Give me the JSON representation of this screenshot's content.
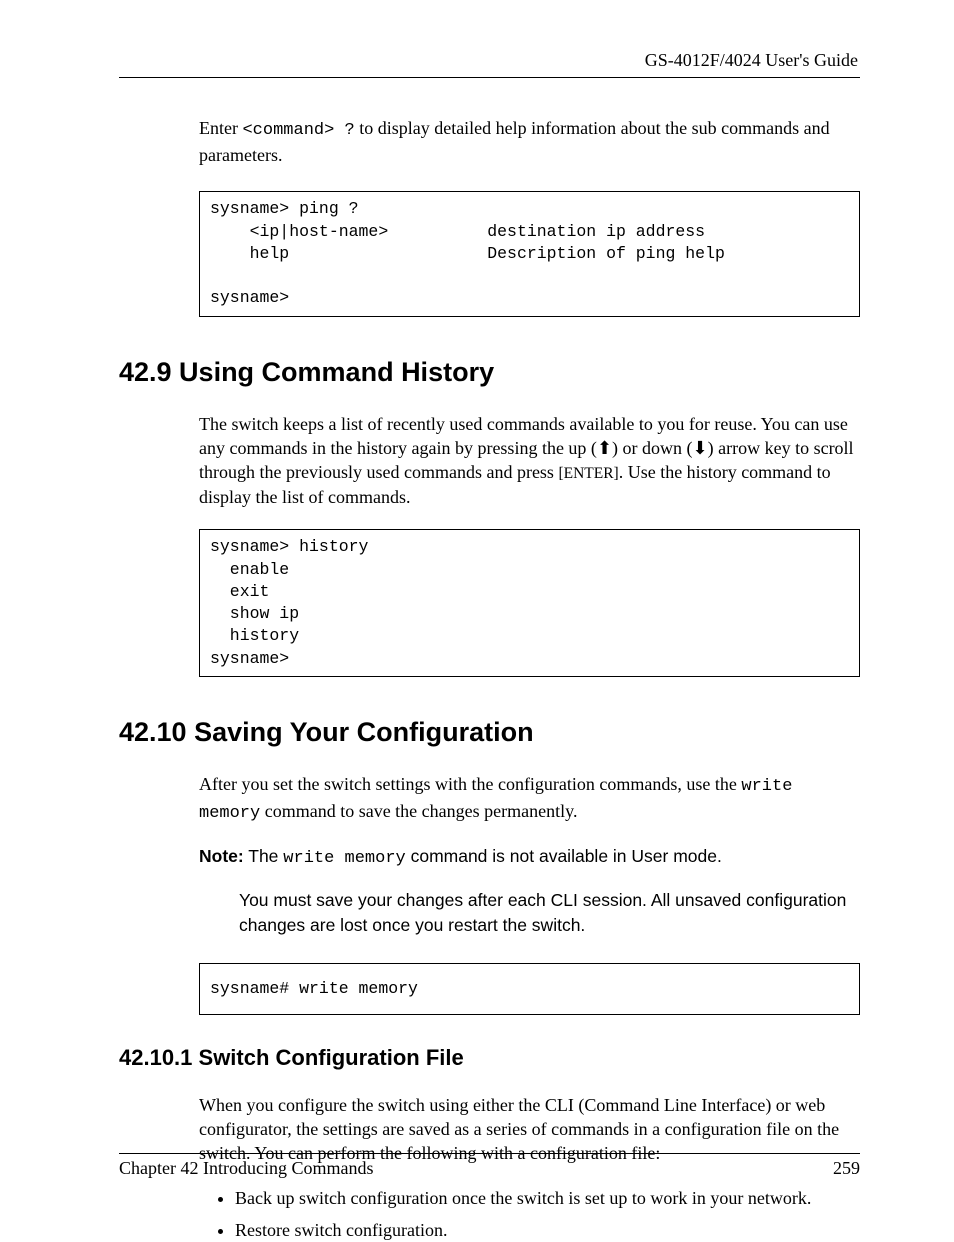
{
  "header": {
    "running": "GS-4012F/4024 User's Guide"
  },
  "intro": {
    "pre": "Enter ",
    "cmd": "<command> ?",
    "post": " to display detailed help information about the sub commands and parameters."
  },
  "code1": "sysname> ping ?\n    <ip|host-name>          destination ip address\n    help                    Description of ping help\n\nsysname>",
  "s1": {
    "heading": "42.9  Using Command History",
    "p1a": "The switch keeps a list of recently used commands available to you for reuse. You can use any commands in the history again by pressing the up (",
    "up": "⬆",
    "p1b": ") or down (",
    "down": "⬇",
    "p1c": ") arrow key to scroll through the previously used commands and press ",
    "enter": "[ENTER]",
    "p1d": ". Use the history command to display the list of commands."
  },
  "code2": "sysname> history\n  enable\n  exit\n  show ip\n  history\nsysname>",
  "s2": {
    "heading": "42.10  Saving Your Configuration",
    "p1a": "After you set the switch settings with the configuration commands, use the ",
    "cmd1": "write memory",
    "p1b": " command to save the changes permanently.",
    "note_label": "Note:",
    "note_a": " The ",
    "note_cmd": "write memory",
    "note_b": " command is not available in User mode.",
    "note_body": "You must save your changes after each CLI session. All unsaved configuration changes are lost once you restart the switch."
  },
  "code3": "sysname# write memory",
  "s3": {
    "heading": "42.10.1  Switch Configuration File",
    "p1": "When you configure the switch using either the CLI (Command Line Interface) or web configurator, the settings are saved as a series of commands in a configuration file on the switch. You can perform the following with a configuration file:",
    "bullets": [
      "Back up switch configuration once the switch is set up to work in your network.",
      "Restore switch configuration."
    ]
  },
  "footer": {
    "chapter": "Chapter 42 Introducing Commands",
    "page": "259"
  }
}
